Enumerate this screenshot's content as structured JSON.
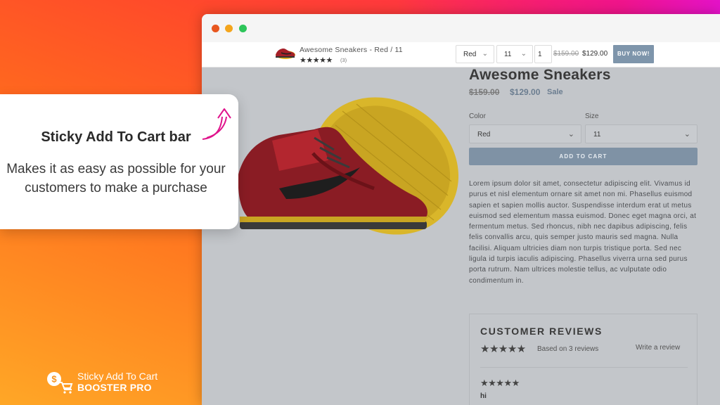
{
  "colors": {
    "accent": "#7f92a5",
    "gradient_start": "#ff4a2a",
    "gradient_end": "#ffa726",
    "arrow": "#e0148c"
  },
  "sticky_bar": {
    "product_title": "Awesome Sneakers - Red / 11",
    "stars": "★★★★★",
    "review_count": "(3)",
    "color_value": "Red",
    "size_value": "11",
    "quantity": "1",
    "old_price": "$159.00",
    "new_price": "$129.00",
    "buy_label": "BUY NOW!"
  },
  "product": {
    "title": "Awesome Sneakers",
    "old_price": "$159.00",
    "new_price": "$129.00",
    "sale_label": "Sale",
    "color_label": "Color",
    "color_value": "Red",
    "size_label": "Size",
    "size_value": "11",
    "add_to_cart": "ADD TO CART",
    "description": "Lorem ipsum dolor sit amet, consectetur adipiscing elit. Vivamus id purus et nisl elementum ornare sit amet non mi. Phasellus euismod sapien et sapien mollis auctor. Suspendisse interdum erat ut metus euismod sed elementum massa euismod. Donec eget magna orci, at fermentum metus. Sed rhoncus, nibh nec dapibus adipiscing, felis felis convallis arcu, quis semper justo mauris sed magna. Nulla facilisi. Aliquam ultricies diam non turpis tristique porta. Sed nec ligula id turpis iaculis adipiscing. Phasellus viverra urna sed purus porta rutrum. Nam ultrices molestie tellus, ac vulputate odio condimentum in."
  },
  "reviews": {
    "heading": "CUSTOMER REVIEWS",
    "stars": "★★★★★",
    "based_on": "Based on 3 reviews",
    "write_review": "Write a review",
    "first_review_stars": "★★★★★",
    "first_review_title": "hi"
  },
  "callout": {
    "heading": "Sticky Add To Cart bar",
    "body": "Makes it as easy as possible for your customers to make a purchase"
  },
  "logo": {
    "line1": "Sticky Add To Cart",
    "line2": "BOOSTER PRO"
  },
  "icons": {
    "dropdown": "chevron-down-icon",
    "arrow": "curved-arrow-icon",
    "logo": "dollar-cart-icon"
  }
}
